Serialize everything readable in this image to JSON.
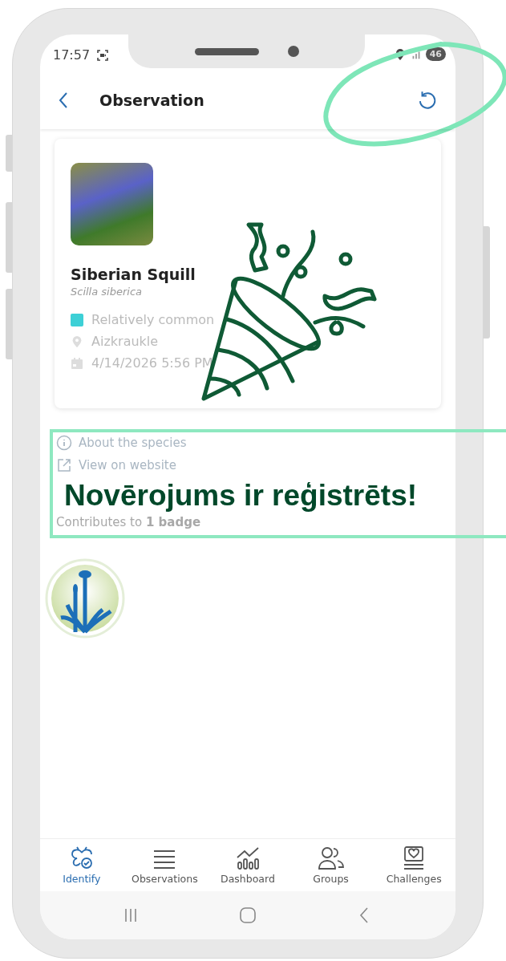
{
  "status_bar": {
    "time": "17:57",
    "battery": "46"
  },
  "header": {
    "title": "Observation"
  },
  "observation": {
    "common_name": "Siberian Squill",
    "scientific_name": "Scilla siberica",
    "details": [
      {
        "kind": "rarity",
        "text": "Relatively common",
        "color": "#3dd0d6"
      },
      {
        "kind": "location",
        "text": "Aizkraukle"
      },
      {
        "kind": "date",
        "text": "4/14/2026 5:56 PM"
      }
    ]
  },
  "links": [
    {
      "kind": "info",
      "label": "About the species"
    },
    {
      "kind": "external",
      "label": "View on website"
    }
  ],
  "badges": {
    "summary": "Contributes to **1 badge**"
  },
  "banner": {
    "message": "Novērojums ir reģistrēts!"
  },
  "bottom_nav": [
    {
      "kind": "identify",
      "label": "Identify",
      "selected": true
    },
    {
      "kind": "observations",
      "label": "Observations",
      "selected": false
    },
    {
      "kind": "dashboard",
      "label": "Dashboard",
      "selected": false
    },
    {
      "kind": "groups",
      "label": "Groups",
      "selected": false
    },
    {
      "kind": "challenges",
      "label": "Challenges",
      "selected": false
    }
  ]
}
